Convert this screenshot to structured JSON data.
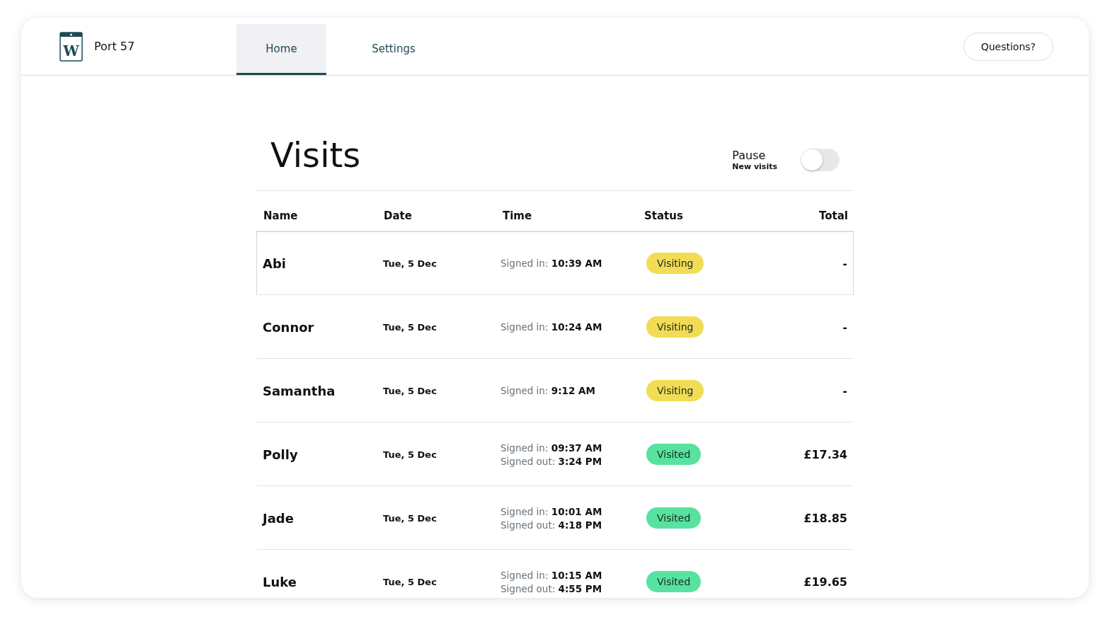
{
  "brand": {
    "name": "Port 57",
    "logo_letter": "W"
  },
  "tabs": [
    {
      "label": "Home",
      "selected": true
    },
    {
      "label": "Settings",
      "selected": false
    }
  ],
  "help_button": "Questions?",
  "page": {
    "title": "Visits",
    "pause": {
      "label": "Pause",
      "sublabel": "New visits",
      "on": false
    }
  },
  "table": {
    "columns": [
      "Name",
      "Date",
      "Time",
      "Status",
      "Total"
    ],
    "rows": [
      {
        "name": "Abi",
        "date": "Tue, 5 Dec",
        "times": [
          "Signed in: **10:39 AM**"
        ],
        "status": "Visiting",
        "kind": "visiting",
        "total": "-",
        "selected": true
      },
      {
        "name": "Connor",
        "date": "Tue, 5 Dec",
        "times": [
          "Signed in: **10:24 AM**"
        ],
        "status": "Visiting",
        "kind": "visiting",
        "total": "-",
        "selected": false
      },
      {
        "name": "Samantha",
        "date": "Tue, 5 Dec",
        "times": [
          "Signed in: **9:12 AM**"
        ],
        "status": "Visiting",
        "kind": "visiting",
        "total": "-",
        "selected": false
      },
      {
        "name": "Polly",
        "date": "Tue, 5 Dec",
        "times": [
          "Signed in: **09:37 AM**",
          "Signed out: **3:24 PM**"
        ],
        "status": "Visited",
        "kind": "visited",
        "total": "£17.34",
        "selected": false
      },
      {
        "name": "Jade",
        "date": "Tue, 5 Dec",
        "times": [
          "Signed in: **10:01 AM**",
          "Signed out: **4:18 PM**"
        ],
        "status": "Visited",
        "kind": "visited",
        "total": "£18.85",
        "selected": false
      },
      {
        "name": "Luke",
        "date": "Tue, 5 Dec",
        "times": [
          "Signed in: **10:15 AM**",
          "Signed out: **4:55 PM**"
        ],
        "status": "Visited",
        "kind": "visited",
        "total": "£19.65",
        "selected": false
      }
    ]
  }
}
